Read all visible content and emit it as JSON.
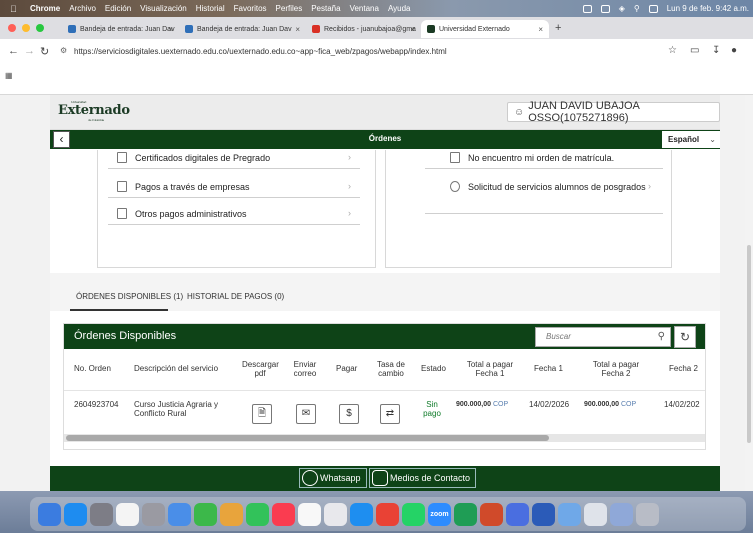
{
  "menubar": {
    "items": [
      "Chrome",
      "Archivo",
      "Edición",
      "Visualización",
      "Historial",
      "Favoritos",
      "Perfiles",
      "Pestaña",
      "Ventana",
      "Ayuda"
    ],
    "datetime": "Lun 9 de feb. 9:42 a.m."
  },
  "browser": {
    "tabs": [
      {
        "title": "Bandeja de entrada: Juan Dav",
        "color": "#2f6fb8"
      },
      {
        "title": "Bandeja de entrada: Juan Dav",
        "color": "#2f6fb8"
      },
      {
        "title": "Recibidos - juanubajoa@gma",
        "color": "#d93025"
      },
      {
        "title": "Universidad Externado",
        "color": "#1b3a24"
      }
    ],
    "url": "https://serviciosdigitales.uexternado.edu.co/uexternado.edu.co~app~fica_web/zpagos/webapp/index.html"
  },
  "header": {
    "logo": "Externado",
    "logo_sub": "de Colombia",
    "logo_top": "Universidad",
    "user": "JUAN DAVID UBAJOA OSSO(1075271896)"
  },
  "titlebar": {
    "title": "Órdenes",
    "language": "Español"
  },
  "payments": {
    "left": [
      "Certificados digitales de Pregrado",
      "Pagos a través de empresas",
      "Otros pagos administrativos"
    ],
    "right": [
      "No encuentro mi orden de matrícula.",
      "Solicitud de servicios alumnos de posgrados"
    ]
  },
  "tabs": {
    "available": "ÓRDENES DISPONIBLES (1)",
    "history": "HISTORIAL DE PAGOS (0)"
  },
  "orders": {
    "title": "Órdenes Disponibles",
    "search_placeholder": "Buscar",
    "columns": {
      "num": "No. Orden",
      "desc": "Descripción del servicio",
      "pdf": "Descargar pdf",
      "email": "Enviar correo",
      "pay": "Pagar",
      "rate": "Tasa de cambio",
      "status": "Estado",
      "total1": "Total a pagar Fecha 1",
      "date1": "Fecha 1",
      "total2": "Total a pagar Fecha 2",
      "date2": "Fecha 2"
    },
    "rows": [
      {
        "num": "2604923704",
        "desc": "Curso Justicia Agraria y Conflicto Rural",
        "status": "Sin pago",
        "total1": "900.000,00",
        "cur1": "COP",
        "date1": "14/02/2026",
        "total2": "900.000,00",
        "cur2": "COP",
        "date2": "14/02/202"
      }
    ]
  },
  "footer": {
    "whatsapp": "Whatsapp",
    "contact": "Medios de Contacto"
  },
  "dock": {
    "zoom_label": "zoom"
  },
  "colors": {
    "brand_green": "#0e4317",
    "status_green": "#0e7a28"
  }
}
